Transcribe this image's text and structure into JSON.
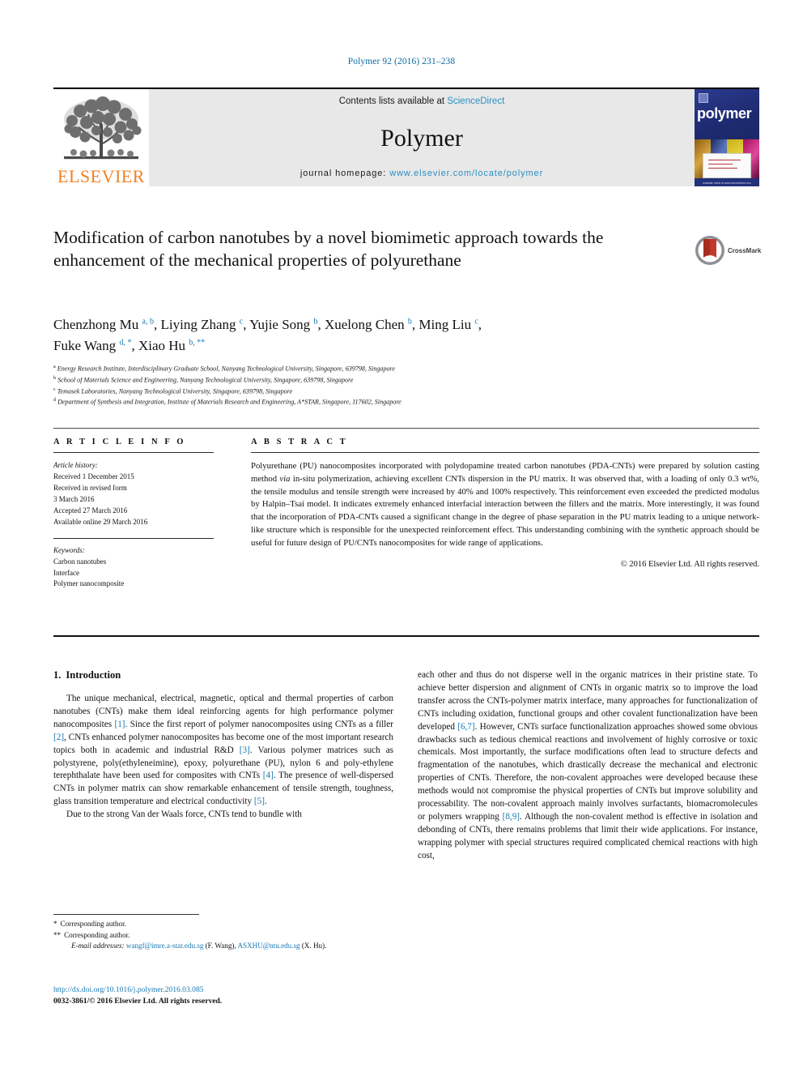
{
  "journal_ref": "Polymer 92 (2016) 231–238",
  "masthead": {
    "publisher_name": "ELSEVIER",
    "contents_prefix": "Contents lists available at ",
    "contents_link": "ScienceDirect",
    "journal_title": "Polymer",
    "homepage_prefix": "journal homepage: ",
    "homepage_url": "www.elsevier.com/locate/polymer",
    "cover_word": "polymer",
    "cover_footer": "Available online at www.sciencedirect.com"
  },
  "article": {
    "title": "Modification of carbon nanotubes by a novel biomimetic approach towards the enhancement of the mechanical properties of polyurethane",
    "crossmark_label": "CrossMark",
    "authors_line1": [
      {
        "name": "Chenzhong Mu",
        "sup": "a, b",
        "sep": ", "
      },
      {
        "name": "Liying Zhang",
        "sup": "c",
        "sep": ", "
      },
      {
        "name": "Yujie Song",
        "sup": "b",
        "sep": ", "
      },
      {
        "name": "Xuelong Chen",
        "sup": "b",
        "sep": ", "
      },
      {
        "name": "Ming Liu",
        "sup": "c",
        "sep": ","
      }
    ],
    "authors_line2": [
      {
        "name": "Fuke Wang",
        "sup": "d, *",
        "sep": ", "
      },
      {
        "name": "Xiao Hu",
        "sup": "b, **",
        "sep": ""
      }
    ],
    "affiliations": [
      {
        "mark": "a",
        "text": "Energy Research Institute, Interdisciplinary Graduate School, Nanyang Technological University, Singapore, 639798, Singapore"
      },
      {
        "mark": "b",
        "text": "School of Materials Science and Engineering, Nanyang Technological University, Singapore, 639798, Singapore"
      },
      {
        "mark": "c",
        "text": "Temasek Laboratories, Nanyang Technological University, Singapore, 639798, Singapore"
      },
      {
        "mark": "d",
        "text": "Department of Synthesis and Integration, Institute of Materials Research and Engineering, A*STAR, Singapore, 117602, Singapore"
      }
    ]
  },
  "article_info": {
    "heading": "A R T I C L E   I N F O",
    "history_label": "Article history:",
    "history": [
      "Received 1 December 2015",
      "Received in revised form",
      "3 March 2016",
      "Accepted 27 March 2016",
      "Available online 29 March 2016"
    ],
    "keywords_label": "Keywords:",
    "keywords": [
      "Carbon nanotubes",
      "Interface",
      "Polymer nanocomposite"
    ]
  },
  "abstract": {
    "heading": "A B S T R A C T",
    "part1": "Polyurethane (PU) nanocomposites incorporated with polydopamine treated carbon nanotubes (PDA-CNTs) were prepared by solution casting method ",
    "italic1": "via",
    "part2": " in-situ polymerization, achieving excellent CNTs dispersion in the PU matrix. It was observed that, with a loading of only 0.3 wt%, the tensile modulus and tensile strength were increased by 40% and 100% respectively. This reinforcement even exceeded the predicted modulus by Halpin–Tsai model. It indicates extremely enhanced interfacial interaction between the fillers and the matrix. More interestingly, it was found that the incorporation of PDA-CNTs caused a significant change in the degree of phase separation in the PU matrix leading to a unique network-like structure which is responsible for the unexpected reinforcement effect. This understanding combining with the synthetic approach should be useful for future design of PU/CNTs nanocomposites for wide range of applications.",
    "copyright": "© 2016 Elsevier Ltd. All rights reserved."
  },
  "body": {
    "section_number": "1.",
    "section_title": "Introduction",
    "left_paragraphs": [
      {
        "runs": [
          {
            "t": "The unique mechanical, electrical, magnetic, optical and thermal properties of carbon nanotubes (CNTs) make them ideal reinforcing agents for high performance polymer nanocomposites "
          },
          {
            "t": "[1]",
            "ref": true
          },
          {
            "t": ". Since the first report of polymer nanocomposites using CNTs as a filler "
          },
          {
            "t": "[2]",
            "ref": true
          },
          {
            "t": ", CNTs enhanced polymer nanocomposites has become one of the most important research topics both in academic and industrial R&D "
          },
          {
            "t": "[3]",
            "ref": true
          },
          {
            "t": ". Various polymer matrices such as polystyrene, poly(ethyleneimine), epoxy, polyurethane (PU), nylon 6 and poly-ethylene terephthalate have been used for composites with CNTs "
          },
          {
            "t": "[4]",
            "ref": true
          },
          {
            "t": ". The presence of well-dispersed CNTs in polymer matrix can show remarkable enhancement of tensile strength, toughness, glass transition temperature and electrical conductivity "
          },
          {
            "t": "[5]",
            "ref": true
          },
          {
            "t": "."
          }
        ]
      },
      {
        "runs": [
          {
            "t": "Due to the strong Van der Waals force, CNTs tend to bundle with"
          }
        ]
      }
    ],
    "right_paragraphs": [
      {
        "continued": true,
        "runs": [
          {
            "t": "each other and thus do not disperse well in the organic matrices in their pristine state. To achieve better dispersion and alignment of CNTs in organic matrix so to improve the load transfer across the CNTs-polymer matrix interface, many approaches for functionalization of CNTs including oxidation, functional groups and other covalent functionalization have been developed "
          },
          {
            "t": "[6,7]",
            "ref": true
          },
          {
            "t": ". However, CNTs surface functionalization approaches showed some obvious drawbacks such as tedious chemical reactions and involvement of highly corrosive or toxic chemicals. Most importantly, the surface modifications often lead to structure defects and fragmentation of the nanotubes, which drastically decrease the mechanical and electronic properties of CNTs. Therefore, the non-covalent approaches were developed because these methods would not compromise the physical properties of CNTs but improve solubility and processability. The non-covalent approach mainly involves surfactants, biomacromolecules or polymers wrapping "
          },
          {
            "t": "[8,9]",
            "ref": true
          },
          {
            "t": ". Although the non-covalent method is effective in isolation and debonding of CNTs, there remains problems that limit their wide applications. For instance, wrapping polymer with special structures required complicated chemical reactions with high cost,"
          }
        ]
      }
    ]
  },
  "footnotes": {
    "star1_mark": "*",
    "star1_text": "Corresponding author.",
    "star2_mark": "**",
    "star2_text": "Corresponding author.",
    "email_label": "E-mail addresses:",
    "email1": "wangf@imre.a-star.edu.sg",
    "email1_owner": "(F. Wang)",
    "email2": "ASXHU@ntu.edu.sg",
    "email2_owner": "(X. Hu)."
  },
  "doi": {
    "url": "http://dx.doi.org/10.1016/j.polymer.2016.03.085",
    "issn_line": "0032-3861/© 2016 Elsevier Ltd. All rights reserved."
  },
  "colors": {
    "link_blue": "#1878b4",
    "science_direct_blue": "#2b8fc4",
    "elsevier_orange": "#f08123",
    "masthead_grey": "#e8e8e8",
    "cover_navy": "#23307a",
    "crossmark_red": "#c0392b"
  }
}
